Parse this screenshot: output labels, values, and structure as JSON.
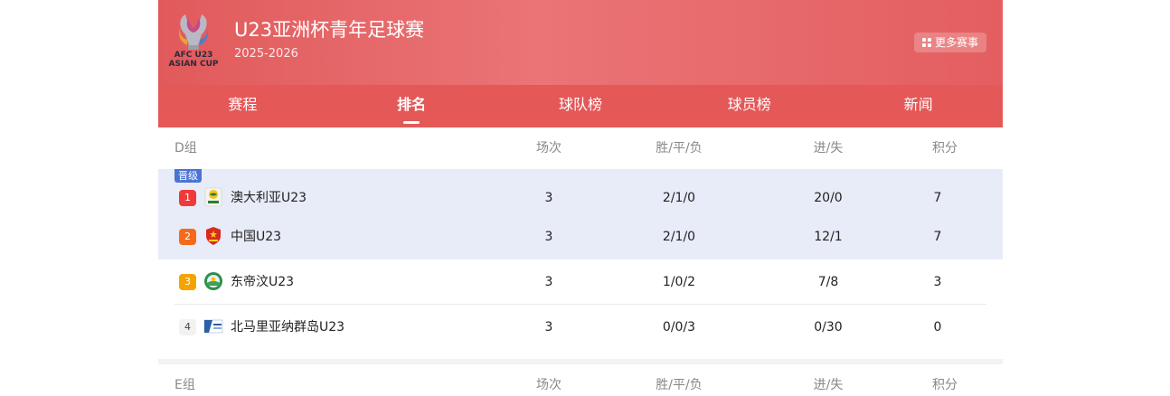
{
  "header": {
    "logo_text": [
      "AFC U23",
      "ASIAN CUP"
    ],
    "title": "U23亚洲杯青年足球赛",
    "season": "2025-2026",
    "more_label": "更多赛事"
  },
  "tabs": [
    {
      "label": "赛程",
      "active": false
    },
    {
      "label": "排名",
      "active": true
    },
    {
      "label": "球队榜",
      "active": false
    },
    {
      "label": "球员榜",
      "active": false
    },
    {
      "label": "新闻",
      "active": false
    }
  ],
  "columns": {
    "played": "场次",
    "wdl": "胜/平/负",
    "goals": "进/失",
    "points": "积分"
  },
  "groups": [
    {
      "name": "D组",
      "qualified_label": "晋级",
      "teams": [
        {
          "rank": "1",
          "name": "澳大利亚U23",
          "played": "3",
          "wdl": "2/1/0",
          "goals": "20/0",
          "points": "7",
          "rank_color": "#f03a3a",
          "logo_icon": "australia-crest-icon"
        },
        {
          "rank": "2",
          "name": "中国U23",
          "played": "3",
          "wdl": "2/1/0",
          "goals": "12/1",
          "points": "7",
          "rank_color": "#f56a1a",
          "logo_icon": "china-crest-icon"
        },
        {
          "rank": "3",
          "name": "东帝汶U23",
          "played": "3",
          "wdl": "1/0/2",
          "goals": "7/8",
          "points": "3",
          "rank_color": "#f5a300",
          "logo_icon": "timor-leste-crest-icon"
        },
        {
          "rank": "4",
          "name": "北马里亚纳群岛U23",
          "played": "3",
          "wdl": "0/0/3",
          "goals": "0/30",
          "points": "0",
          "rank_color": "#f2f2f2",
          "logo_icon": "northern-mariana-crest-icon"
        }
      ]
    },
    {
      "name": "E组"
    }
  ],
  "colors": {
    "header_red": "#e45858",
    "promoted_bg": "#e8ebf8",
    "qualified_badge": "#4a73d6"
  }
}
